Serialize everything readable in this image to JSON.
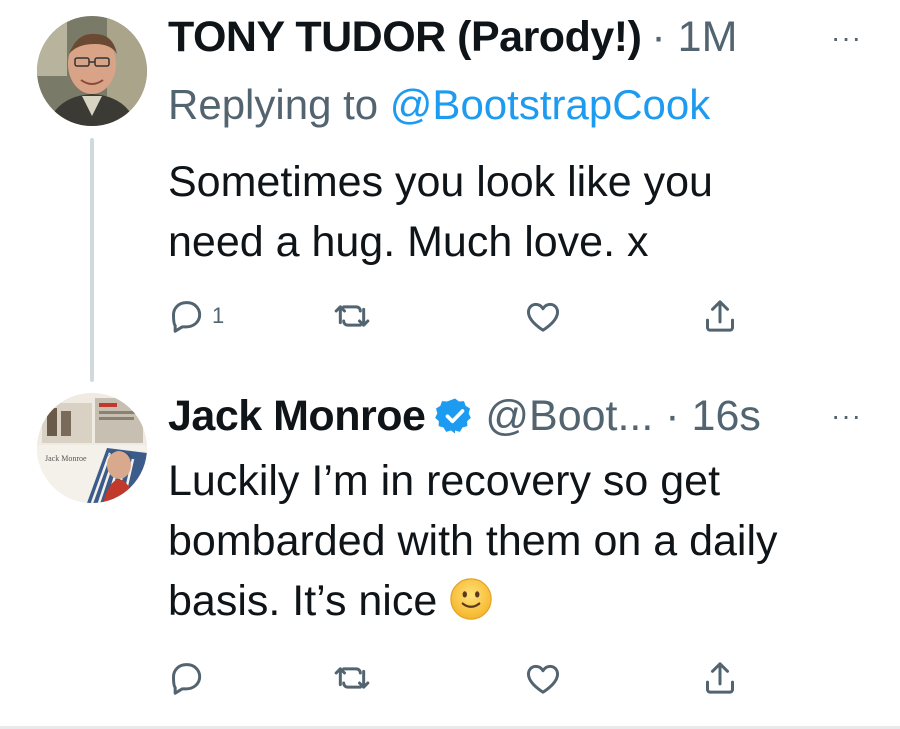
{
  "tweets": [
    {
      "author_name": "TONY TUDOR (Parody!)",
      "time": "· 1M",
      "replying_prefix": "Replying to ",
      "replying_handle": "@BootstrapCook",
      "text": "Sometimes you look like you\nneed a hug. Much love. x",
      "reply_count": "1",
      "avatar": "man-portrait-photo"
    },
    {
      "author_name": "Jack Monroe",
      "verified": true,
      "handle_time": "@Boot... · 16s",
      "text": "Luckily I’m in recovery so get\nbombarded with them on a daily\nbasis. It’s nice",
      "emoji": "slightly-smiling-face",
      "avatar": "newspaper-collage-photo",
      "avatar_caption": "Jack Monroe"
    }
  ],
  "more_label": "···",
  "icons": {
    "reply": "reply-icon",
    "retweet": "retweet-icon",
    "like": "like-icon",
    "share": "share-icon",
    "verified": "verified-badge-icon"
  },
  "colors": {
    "text": "#0f1419",
    "secondary": "#536471",
    "link": "#1d9bf0",
    "thread_line": "#cfd9de"
  }
}
